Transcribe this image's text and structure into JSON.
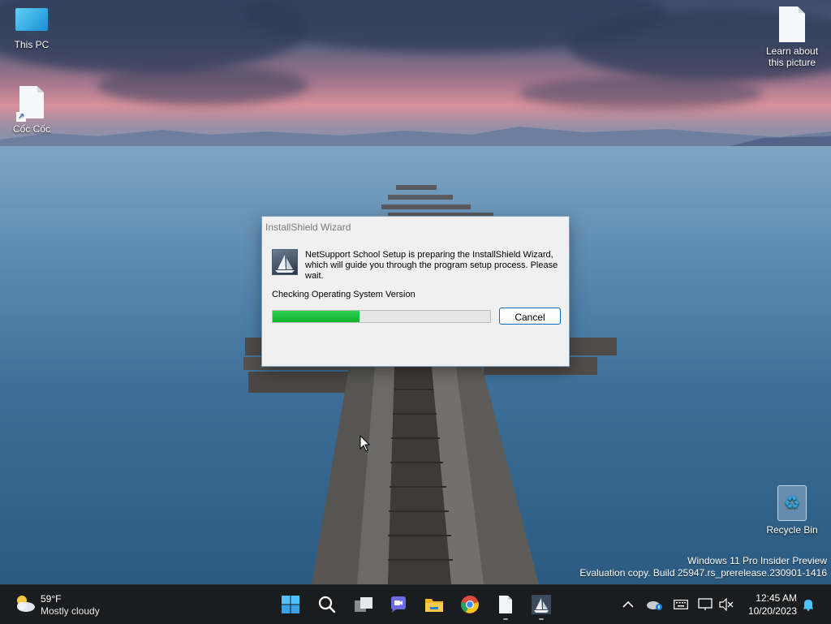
{
  "desktop": {
    "icons": [
      {
        "label": "This PC",
        "icon": "monitor-icon"
      },
      {
        "label": "Cốc Cốc",
        "icon": "document-shortcut-icon"
      },
      {
        "label": "Learn about this picture",
        "icon": "document-icon"
      },
      {
        "label": "Recycle Bin",
        "icon": "recycle-bin-icon"
      }
    ],
    "watermark": {
      "line1": "Windows 11 Pro Insider Preview",
      "line2": "Evaluation copy. Build 25947.rs_prerelease.230901-1416"
    }
  },
  "dialog": {
    "title": "InstallShield Wizard",
    "message": "NetSupport School Setup is preparing the InstallShield Wizard, which will guide you through the program setup process.  Please wait.",
    "status": "Checking Operating System Version",
    "progress": 0.4,
    "cancel_label": "Cancel",
    "progress_color": "#1bc23d",
    "button_border_color": "#0f6cbd"
  },
  "taskbar": {
    "weather": {
      "temp": "59°F",
      "condition": "Mostly cloudy",
      "icon": "partly-cloudy-icon"
    },
    "apps": [
      {
        "name": "start",
        "icon": "windows-start-icon"
      },
      {
        "name": "search",
        "icon": "search-icon"
      },
      {
        "name": "task-view",
        "icon": "task-view-icon"
      },
      {
        "name": "teams-chat",
        "icon": "chat-icon"
      },
      {
        "name": "file-explorer",
        "icon": "folder-icon"
      },
      {
        "name": "chrome",
        "icon": "chrome-icon"
      },
      {
        "name": "document",
        "icon": "document-icon"
      },
      {
        "name": "installshield",
        "icon": "installer-icon"
      }
    ],
    "tray": [
      "chevron-up-icon",
      "onedrive-icon",
      "keyboard-icon",
      "display-icon",
      "volume-muted-icon"
    ],
    "clock": {
      "time": "12:45 AM",
      "date": "10/20/2023"
    },
    "notification_icon": "bell-icon",
    "background": "#1b1c1e"
  }
}
